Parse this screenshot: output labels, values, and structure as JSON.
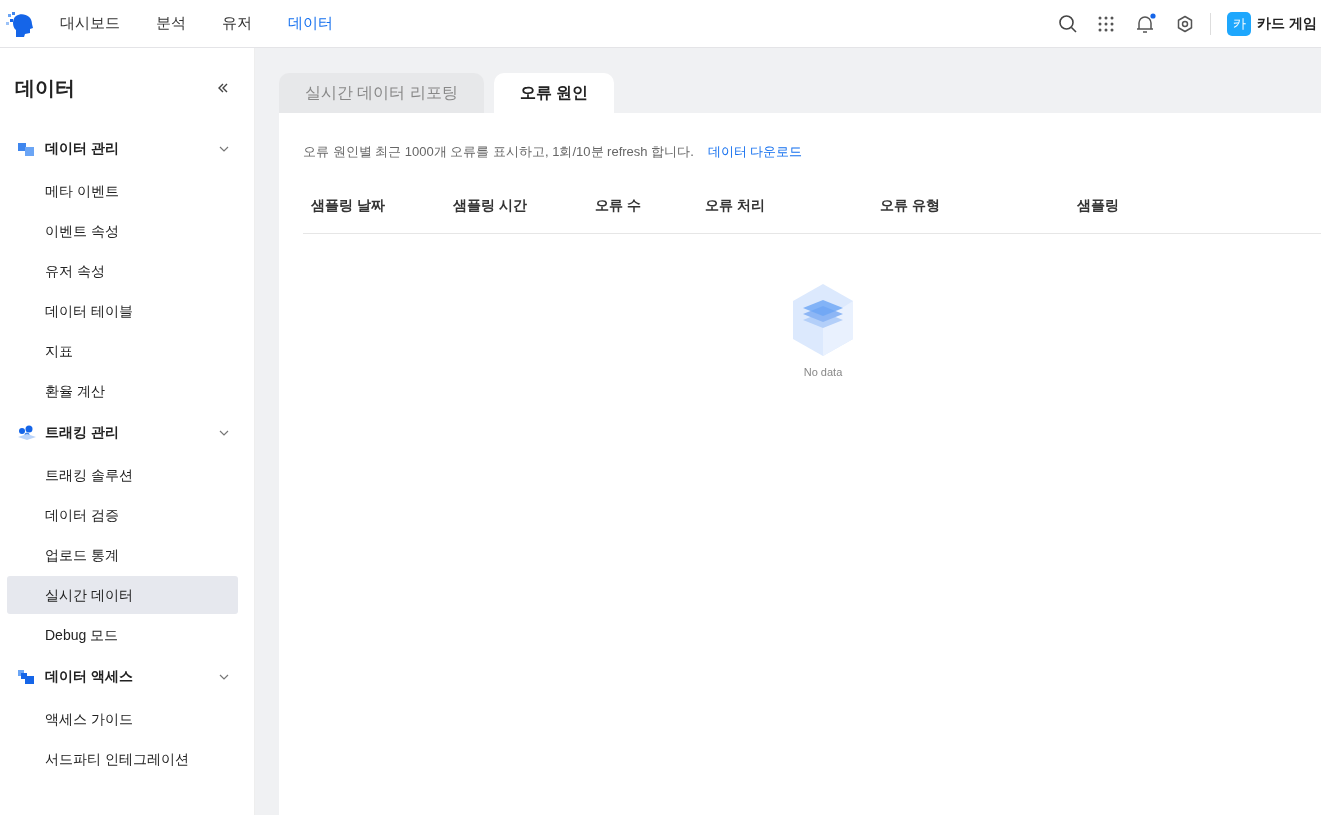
{
  "top_nav": [
    {
      "label": "대시보드",
      "selected": false
    },
    {
      "label": "분석",
      "selected": false
    },
    {
      "label": "유저",
      "selected": false
    },
    {
      "label": "데이터",
      "selected": true
    }
  ],
  "project": {
    "avatar": "카",
    "name": "카드 게임"
  },
  "sidebar": {
    "title": "데이터",
    "groups": [
      {
        "label": "데이터 관리",
        "expanded": true,
        "items": [
          {
            "label": "메타 이벤트",
            "selected": false
          },
          {
            "label": "이벤트 속성",
            "selected": false
          },
          {
            "label": "유저 속성",
            "selected": false
          },
          {
            "label": "데이터 테이블",
            "selected": false
          },
          {
            "label": "지표",
            "selected": false
          },
          {
            "label": "환율 계산",
            "selected": false
          }
        ]
      },
      {
        "label": "트래킹 관리",
        "expanded": true,
        "items": [
          {
            "label": "트래킹 솔루션",
            "selected": false
          },
          {
            "label": "데이터 검증",
            "selected": false
          },
          {
            "label": "업로드 통계",
            "selected": false
          },
          {
            "label": "실시간 데이터",
            "selected": true
          },
          {
            "label": "Debug 모드",
            "selected": false
          }
        ]
      },
      {
        "label": "데이터 액세스",
        "expanded": true,
        "items": [
          {
            "label": "액세스 가이드",
            "selected": false
          },
          {
            "label": "서드파티 인테그레이션",
            "selected": false
          }
        ]
      }
    ]
  },
  "tabs": [
    {
      "label": "실시간 데이터 리포팅",
      "selected": false
    },
    {
      "label": "오류 원인",
      "selected": true
    }
  ],
  "description": "오류 원인별 최근 1000개 오류를 표시하고, 1회/10분 refresh 합니다.",
  "download_link": "데이터 다운로드",
  "table": {
    "columns": [
      "샘플링 날짜",
      "샘플링 시간",
      "오류 수",
      "오류 처리",
      "오류 유형",
      "샘플링"
    ],
    "empty_text": "No data"
  }
}
